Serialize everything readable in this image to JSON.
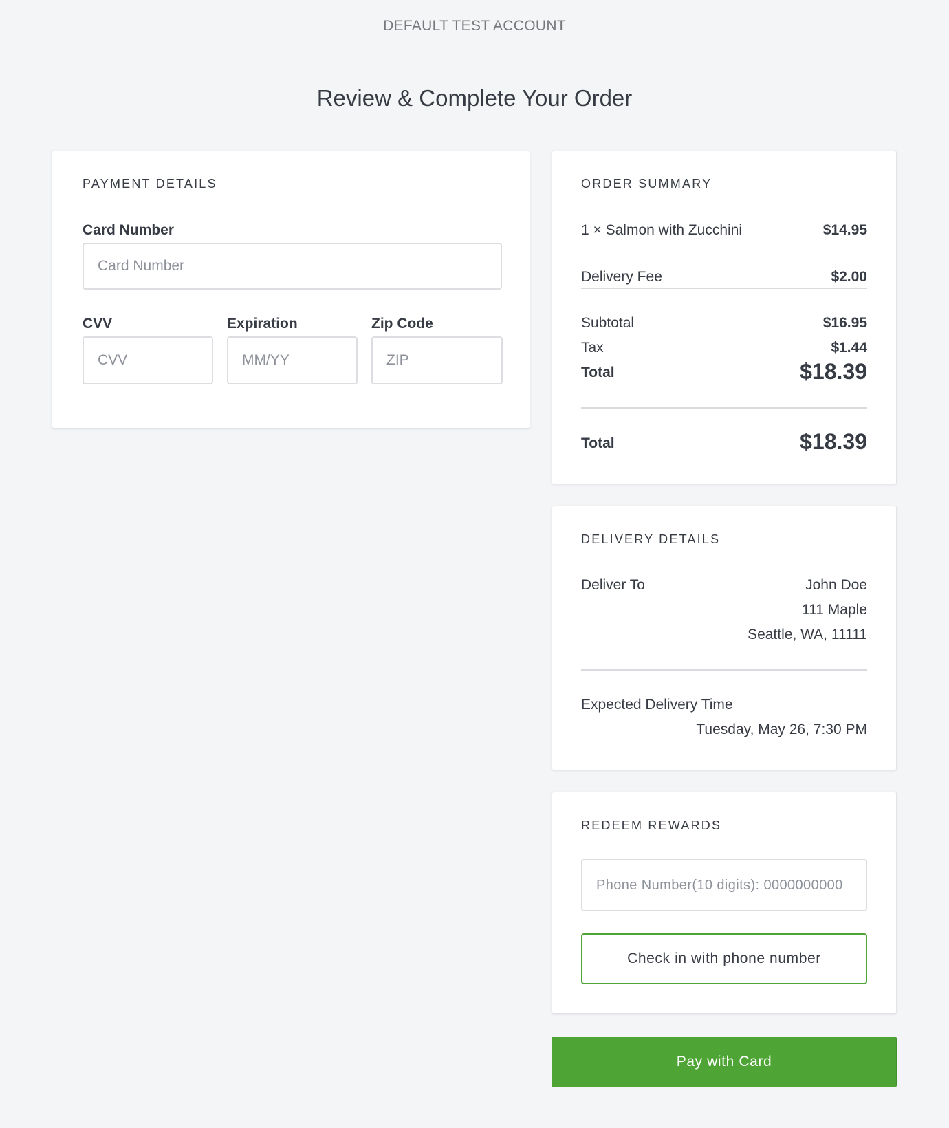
{
  "header": {
    "account": "DEFAULT TEST ACCOUNT",
    "title": "Review & Complete Your Order"
  },
  "payment": {
    "section_title": "PAYMENT DETAILS",
    "card_number_label": "Card Number",
    "card_number_placeholder": "Card Number",
    "cvv_label": "CVV",
    "cvv_placeholder": "CVV",
    "expiration_label": "Expiration",
    "expiration_placeholder": "MM/YY",
    "zip_label": "Zip Code",
    "zip_placeholder": "ZIP"
  },
  "summary": {
    "section_title": "ORDER SUMMARY",
    "item_label": "1 × Salmon with Zucchini",
    "item_price": "$14.95",
    "delivery_fee_label": "Delivery Fee",
    "delivery_fee": "$2.00",
    "subtotal_label": "Subtotal",
    "subtotal": "$16.95",
    "tax_label": "Tax",
    "tax": "$1.44",
    "total_label": "Total",
    "total": "$18.39",
    "grand_total_label": "Total",
    "grand_total": "$18.39"
  },
  "delivery": {
    "section_title": "DELIVERY DETAILS",
    "deliver_to_label": "Deliver To",
    "name": "John Doe",
    "street": "111 Maple",
    "city": "Seattle, WA, 11111",
    "expected_time_label": "Expected Delivery Time",
    "expected_time": "Tuesday, May 26, 7:30 PM"
  },
  "rewards": {
    "section_title": "REDEEM REWARDS",
    "phone_placeholder": "Phone Number(10 digits): 0000000000",
    "check_in_label": "Check in with phone number"
  },
  "pay_button_label": "Pay with Card",
  "colors": {
    "background": "#f4f5f7",
    "accent_green": "#4ea535",
    "text": "#373b44",
    "muted_text": "#76787d"
  }
}
